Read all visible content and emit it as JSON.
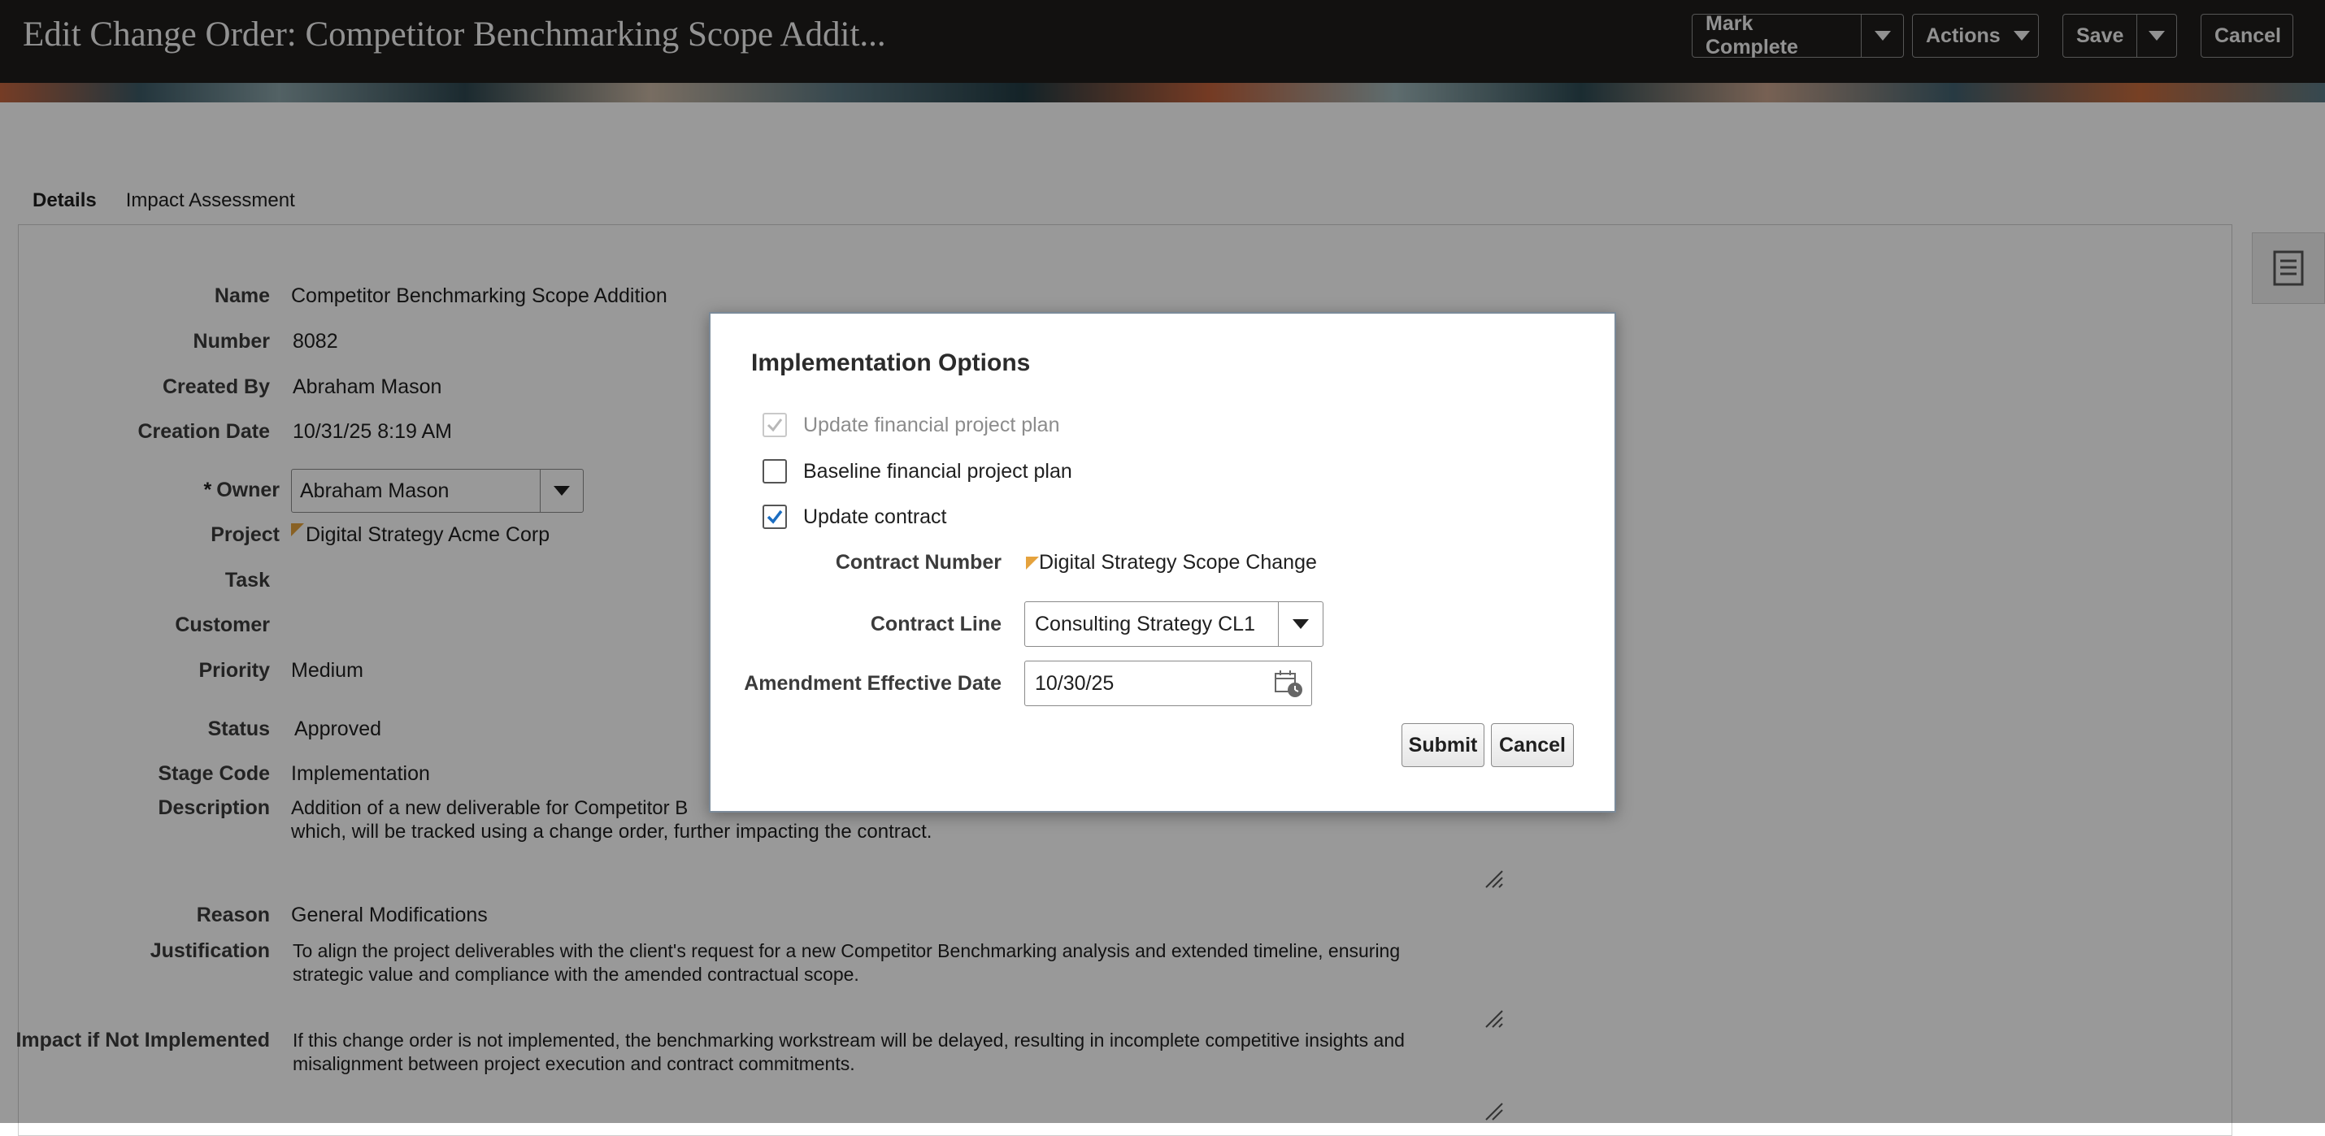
{
  "header": {
    "title": "Edit Change Order: Competitor Benchmarking Scope Addit...",
    "mark_complete": "Mark Complete",
    "actions": "Actions",
    "save": "Save",
    "cancel": "Cancel"
  },
  "tabs": [
    {
      "label": "Details",
      "active": true
    },
    {
      "label": "Impact Assessment",
      "active": false
    }
  ],
  "form": {
    "name_label": "Name",
    "name": "Competitor Benchmarking Scope Addition",
    "number_label": "Number",
    "number": "8082",
    "created_by_label": "Created By",
    "created_by": "Abraham Mason",
    "creation_date_label": "Creation Date",
    "creation_date": "10/31/25 8:19 AM",
    "owner_required": "*",
    "owner_label": "Owner",
    "owner": "Abraham Mason",
    "project_label": "Project",
    "project": "Digital Strategy Acme Corp",
    "task_label": "Task",
    "customer_label": "Customer",
    "priority_label": "Priority",
    "priority": "Medium",
    "status_label": "Status",
    "status": "Approved",
    "stage_code_label": "Stage Code",
    "stage_code": "Implementation",
    "description_label": "Description",
    "description_line1": "Addition of a new deliverable for Competitor B",
    "description_line2": "which, will be tracked using a change order, further impacting the contract.",
    "reason_label": "Reason",
    "reason": "General Modifications",
    "justification_label": "Justification",
    "justification_line1": "To align the project deliverables with the client's request for a new Competitor Benchmarking analysis and extended timeline, ensuring",
    "justification_line2": "strategic value and compliance with the amended contractual scope.",
    "impact_label": "Impact if Not Implemented",
    "impact_line1": "If this change order is not implemented, the benchmarking workstream will be delayed, resulting in incomplete competitive insights and",
    "impact_line2": "misalignment between project execution and contract commitments."
  },
  "dialog": {
    "title": "Implementation Options",
    "update_financial_plan": {
      "label": "Update financial project plan",
      "checked": true,
      "disabled": true
    },
    "baseline_financial_plan": {
      "label": "Baseline financial project plan",
      "checked": false,
      "disabled": false
    },
    "update_contract": {
      "label": "Update contract",
      "checked": true,
      "disabled": false
    },
    "contract_number_label": "Contract Number",
    "contract_number": "Digital Strategy Scope Change",
    "contract_line_label": "Contract Line",
    "contract_line": "Consulting Strategy CL1",
    "amendment_date_label": "Amendment Effective Date",
    "amendment_date": "10/30/25",
    "submit": "Submit",
    "cancel": "Cancel"
  },
  "icons": {
    "dropdown": "chevron-down-icon",
    "calendar": "calendar-icon",
    "side_panel": "document-icon",
    "checkmark": "checkmark-icon"
  },
  "colors": {
    "header_bg": "#1e1d1c",
    "checkbox_accent": "#1b6dc1",
    "required_flag": "#e5a23d"
  }
}
